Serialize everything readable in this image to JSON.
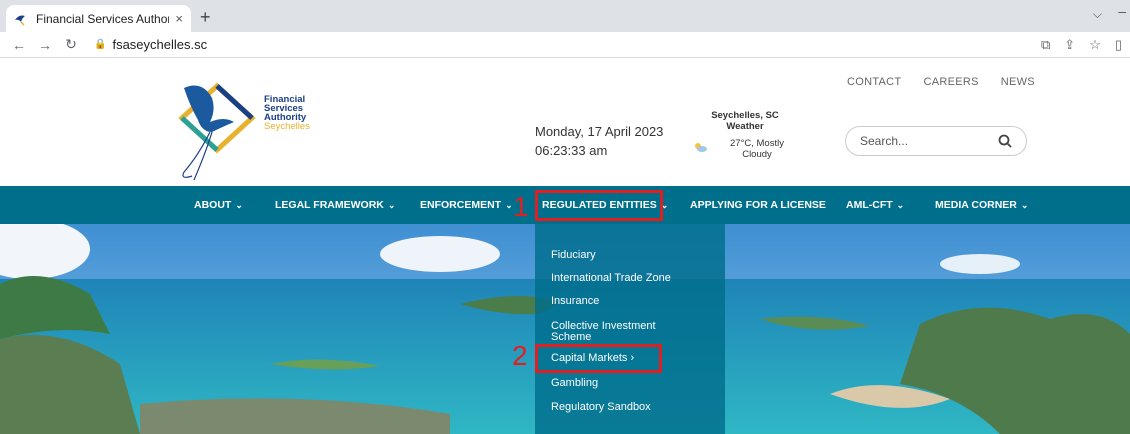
{
  "browser": {
    "tab_title": "Financial Services Authority",
    "tab_close": "×",
    "new_tab": "+",
    "url": "fsaseychelles.sc"
  },
  "header": {
    "logo": {
      "line1": "Financial",
      "line2": "Services",
      "line3": "Authority",
      "line4": "Seychelles"
    },
    "date": "Monday, 17 April 2023",
    "time": "06:23:33 am",
    "weather": {
      "title_line1": "Seychelles, SC",
      "title_line2": "Weather",
      "desc_line1": "27°C, Mostly",
      "desc_line2": "Cloudy"
    },
    "top_links": [
      "CONTACT",
      "CAREERS",
      "NEWS"
    ],
    "search_placeholder": "Search..."
  },
  "nav": {
    "items": [
      "ABOUT",
      "LEGAL FRAMEWORK",
      "ENFORCEMENT",
      "REGULATED ENTITIES",
      "APPLYING FOR A LICENSE",
      "AML-CFT",
      "MEDIA CORNER"
    ]
  },
  "dropdown": {
    "items": [
      "Fiduciary",
      "International Trade Zone",
      "Insurance",
      "Collective Investment",
      "Scheme",
      "Capital Markets ›",
      "Gambling",
      "Regulatory Sandbox"
    ]
  },
  "annotations": {
    "marker1": "1",
    "marker2": "2",
    "color": "#e02020"
  },
  "colors": {
    "nav_bg": "#006f8c",
    "logo_blue": "#1b3f84",
    "logo_gold": "#e8b22e"
  }
}
